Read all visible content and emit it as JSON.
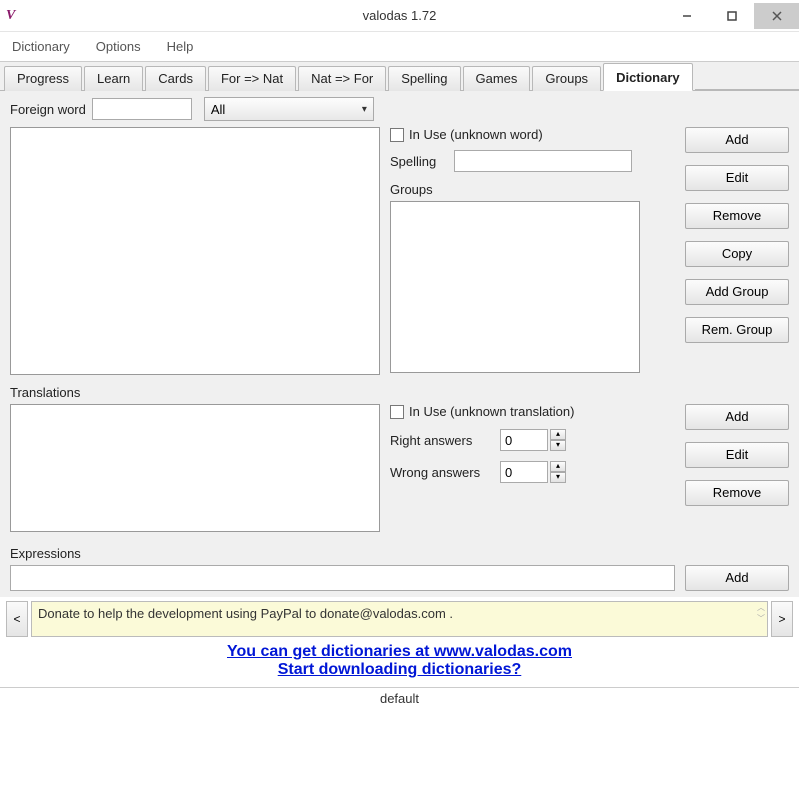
{
  "window": {
    "title": "valodas 1.72",
    "icon_glyph": "V"
  },
  "menu": {
    "items": [
      "Dictionary",
      "Options",
      "Help"
    ]
  },
  "tabs": [
    "Progress",
    "Learn",
    "Cards",
    "For => Nat",
    "Nat => For",
    "Spelling",
    "Games",
    "Groups",
    "Dictionary"
  ],
  "active_tab_index": 8,
  "word_panel": {
    "foreign_label": "Foreign word",
    "foreign_value": "",
    "filter_value": "All",
    "inuse_label": "In Use (unknown word)",
    "spelling_label": "Spelling",
    "spelling_value": "",
    "groups_label": "Groups",
    "buttons": {
      "add": "Add",
      "edit": "Edit",
      "remove": "Remove",
      "copy": "Copy",
      "addgroup": "Add Group",
      "remgroup": "Rem. Group"
    }
  },
  "trans_panel": {
    "label": "Translations",
    "inuse_label": "In Use (unknown translation)",
    "right_label": "Right answers",
    "right_value": "0",
    "wrong_label": "Wrong answers",
    "wrong_value": "0",
    "buttons": {
      "add": "Add",
      "edit": "Edit",
      "remove": "Remove"
    }
  },
  "expr_panel": {
    "label": "Expressions",
    "value": "",
    "button": "Add"
  },
  "donate": {
    "text": "Donate to help the development using PayPal to donate@valodas.com ."
  },
  "footer_links": {
    "link1": "You can get dictionaries at www.valodas.com",
    "link2": "Start downloading dictionaries?"
  },
  "status": "default"
}
